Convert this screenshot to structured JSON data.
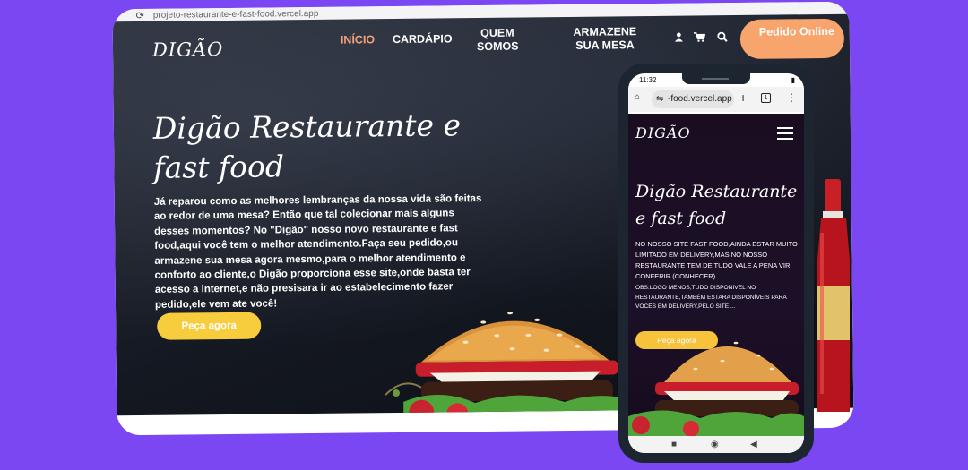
{
  "browser": {
    "reload_icon": "reload-icon",
    "url": "projeto-restaurante-e-fast-food.vercel.app"
  },
  "desktop": {
    "logo": "DIGÃO",
    "menu": [
      {
        "label": "INÍCIO",
        "active": true
      },
      {
        "label": "CARDÁPIO",
        "active": false
      },
      {
        "label": "QUEM SOMOS",
        "active": false
      },
      {
        "label": "ARMAZENE SUA MESA",
        "active": false
      }
    ],
    "icons": [
      "user-icon",
      "cart-icon",
      "search-icon"
    ],
    "order_button": "Pedido Online",
    "hero_title": "Digão Restaurante e fast food",
    "hero_text": "Já reparou como as melhores lembranças da nossa vida são feitas ao redor de uma mesa? Então que tal colecionar mais alguns desses momentos? No \"Digão\" nosso novo restaurante e fast food,aqui você tem o melhor atendimento.Faça seu pedido,ou armazene sua mesa agora mesmo,para o melhor atendimento e conforto ao cliente,o Digão proporciona esse site,onde basta ter acesso a internet,e não presisara ir ao estabelecimento fazer pedido,ele vem ate você!",
    "hero_button": "Peça agora"
  },
  "phone": {
    "time": "11:32",
    "url": "-food.vercel.app",
    "logo": "DIGÃO",
    "title": "Digão Restaurante e fast food",
    "text": "NO NOSSO SITE FAST FOOD,AINDA ESTAR MUITO LIMITADO EM DELIVERY,MAS NO NOSSO RESTAURANTE TEM DE TUDO VALE A PENA VIR CONFERIR (CONHECER).",
    "text2": "OBS:LOGO MENOS,TUDO DISPONIVEL NO RESTAURANTE,TAMBÉM ESTARA DISPONÍVEIS PARA VOCÊS EM DELIVERY,PELO SITE....",
    "button": "Peça agora",
    "tab_count": "1"
  },
  "colors": {
    "background": "#7a47f2",
    "accent_orange": "#f8a46d",
    "button_yellow": "#f7cc3d"
  }
}
